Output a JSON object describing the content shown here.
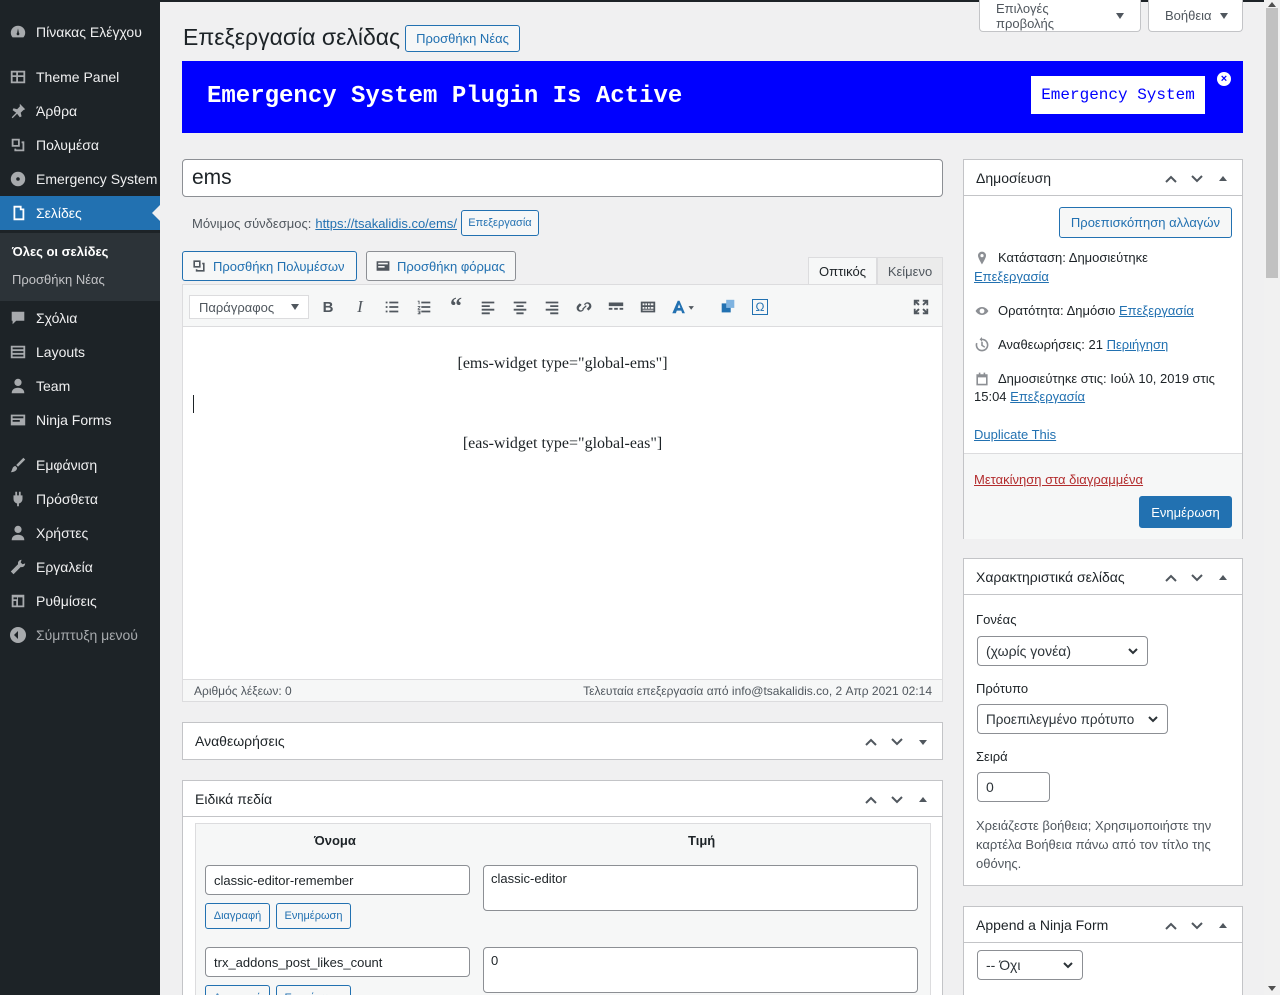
{
  "sidebar": {
    "items": [
      {
        "label": "Πίνακας Ελέγχου",
        "icon": "dashboard-icon"
      },
      {
        "label": "Theme Panel",
        "icon": "grid-icon"
      },
      {
        "label": "Άρθρα",
        "icon": "pin-icon"
      },
      {
        "label": "Πολυμέσα",
        "icon": "media-icon"
      },
      {
        "label": "Emergency System",
        "icon": "radiation-icon"
      },
      {
        "label": "Σελίδες",
        "icon": "page-icon"
      },
      {
        "label": "Σχόλια",
        "icon": "comment-icon"
      },
      {
        "label": "Layouts",
        "icon": "layout-icon"
      },
      {
        "label": "Team",
        "icon": "user-icon"
      },
      {
        "label": "Ninja Forms",
        "icon": "form-icon"
      },
      {
        "label": "Εμφάνιση",
        "icon": "brush-icon"
      },
      {
        "label": "Πρόσθετα",
        "icon": "plugin-icon"
      },
      {
        "label": "Χρήστες",
        "icon": "users-icon"
      },
      {
        "label": "Εργαλεία",
        "icon": "wrench-icon"
      },
      {
        "label": "Ρυθμίσεις",
        "icon": "settings-icon"
      },
      {
        "label": "Σύμπτυξη μενού",
        "icon": "collapse-icon"
      }
    ],
    "submenu": [
      "Όλες οι σελίδες",
      "Προσθήκη Νέας"
    ]
  },
  "screen_options": "Επιλογές προβολής",
  "help": "Βοήθεια",
  "page_title": "Επεξεργασία σελίδας",
  "add_new": "Προσθήκη Νέας",
  "banner": {
    "title": "Emergency System Plugin Is Active",
    "button": "Emergency System",
    "close": "×",
    "color": "#0000ff"
  },
  "post_title": "ems",
  "permalink": {
    "label": "Μόνιμος σύνδεσμος:",
    "url": "https://tsakalidis.co/ems/",
    "edit": "Επεξεργασία"
  },
  "editor": {
    "add_media": "Προσθήκη Πολυμέσων",
    "add_form": "Προσθήκη φόρμας",
    "tab_visual": "Οπτικός",
    "tab_text": "Κείμενο",
    "format": "Παράγραφος",
    "line1": "[ems-widget type=\"global-ems\"]",
    "line2": "[eas-widget type=\"global-eas\"]",
    "word_count": "Αριθμός λέξεων: 0",
    "last_edit": "Τελευταία επεξεργασία από info@tsakalidis.co, 2 Απρ 2021 02:14"
  },
  "revisions": {
    "title": "Αναθεωρήσεις"
  },
  "custom_fields": {
    "title": "Ειδικά πεδία",
    "col_name": "Όνομα",
    "col_value": "Τιμή",
    "delete": "Διαγραφή",
    "update": "Ενημέρωση",
    "rows": [
      {
        "name": "classic-editor-remember",
        "value": "classic-editor"
      },
      {
        "name": "trx_addons_post_likes_count",
        "value": "0"
      }
    ]
  },
  "publish": {
    "title": "Δημοσίευση",
    "preview": "Προεπισκόπηση αλλαγών",
    "status_label": "Κατάσταση:",
    "status_value": "Δημοσιεύτηκε",
    "edit": "Επεξεργασία",
    "visibility_label": "Ορατότητα:",
    "visibility_value": "Δημόσιο",
    "revisions_label": "Αναθεωρήσεις:",
    "revisions_value": "21",
    "browse": "Περιήγηση",
    "published_label": "Δημοσιεύτηκε στις:",
    "published_value": "Ιούλ 10, 2019 στις",
    "published_time": "15:04",
    "duplicate": "Duplicate This",
    "trash": "Μετακίνηση στα διαγραμμένα",
    "update": "Ενημέρωση"
  },
  "attributes": {
    "title": "Χαρακτηριστικά σελίδας",
    "parent_label": "Γονέας",
    "parent_value": "(χωρίς γονέα)",
    "template_label": "Πρότυπο",
    "template_value": "Προεπιλεγμένο πρότυπο",
    "order_label": "Σειρά",
    "order_value": "0",
    "help": "Χρειάζεστε βοήθεια; Χρησιμοποιήστε την καρτέλα Βοήθεια πάνω από τον τίτλο της οθόνης."
  },
  "ninja": {
    "title": "Append a Ninja Form",
    "value": "-- Όχι"
  }
}
